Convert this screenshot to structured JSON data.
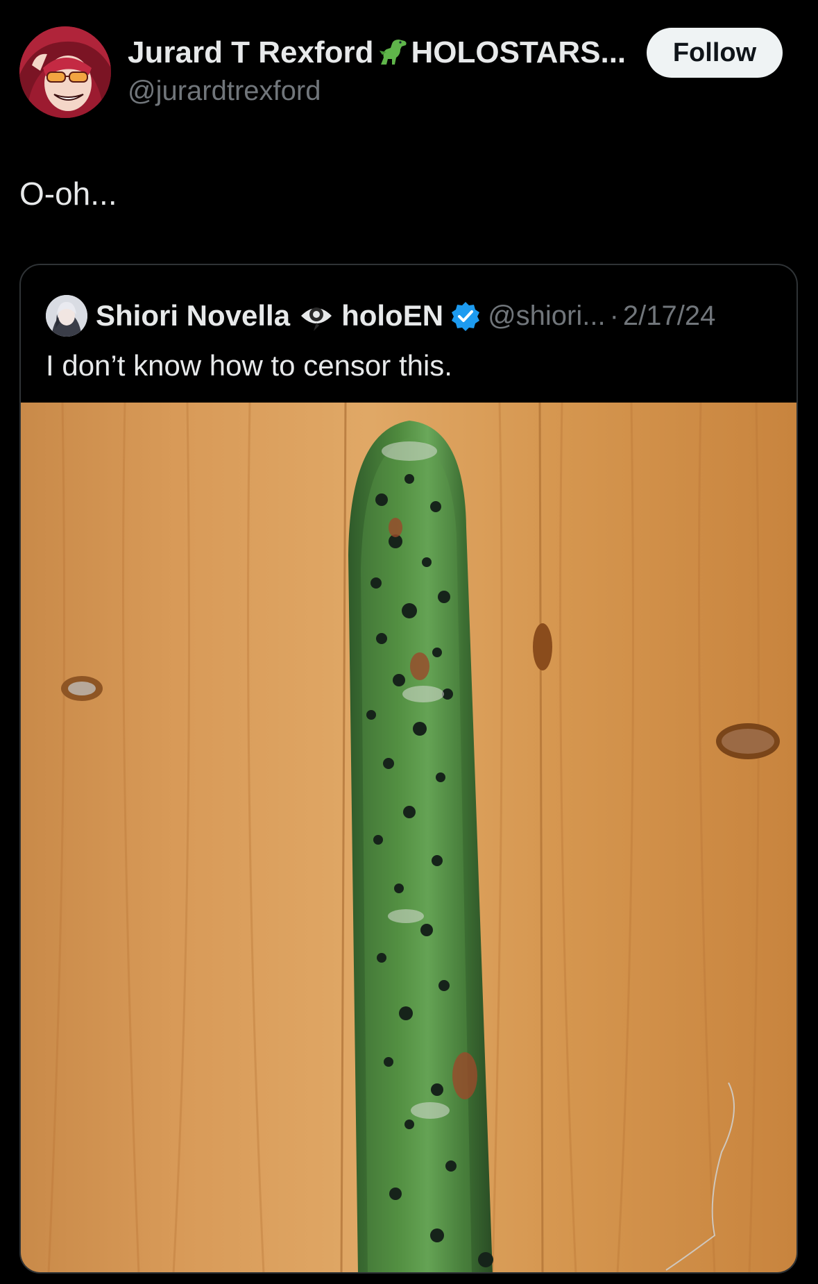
{
  "author": {
    "display_name": "Jurard T Rexford",
    "display_name_suffix": "HOLOSTARS...",
    "emoji_icon": "t-rex-icon",
    "handle": "@jurardtrexford",
    "avatar_icon": "avatar"
  },
  "follow_button": {
    "label": "Follow"
  },
  "tweet": {
    "text": "O-oh..."
  },
  "quoted": {
    "display_name": "Shiori Novella",
    "eye_icon": "eye-icon",
    "org": "holoEN",
    "verified_icon": "verified-badge-icon",
    "handle": "@shiori...",
    "separator": "·",
    "date": "2/17/24",
    "text": "I don’t know how to censor this.",
    "media_icon": "photo-moldy-cucumber"
  },
  "colors": {
    "background": "#000000",
    "text_primary": "#e7e9ea",
    "text_secondary": "#71767b",
    "border": "#2f3336",
    "verified_blue": "#1d9bf0",
    "follow_bg": "#eff3f4"
  }
}
